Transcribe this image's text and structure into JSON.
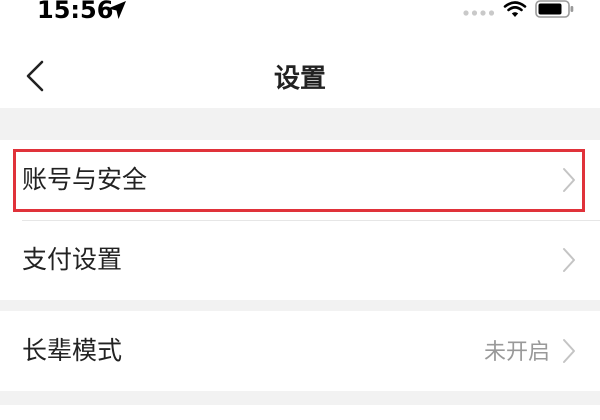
{
  "status_bar": {
    "time": "15:56",
    "icons": [
      "location-arrow-icon",
      "signal-icon",
      "wifi-icon",
      "battery-icon"
    ]
  },
  "nav": {
    "title": "设置",
    "back_icon": "chevron-left-icon"
  },
  "settings": {
    "items": [
      {
        "label": "账号与安全",
        "value": "",
        "highlighted": true
      },
      {
        "label": "支付设置",
        "value": ""
      },
      {
        "label": "长辈模式",
        "value": "未开启"
      }
    ]
  },
  "colors": {
    "background": "#f2f2f2",
    "card": "#ffffff",
    "text": "#222222",
    "secondary_text": "#999999",
    "chevron": "#c4c4c4",
    "highlight": "#e0323a"
  }
}
